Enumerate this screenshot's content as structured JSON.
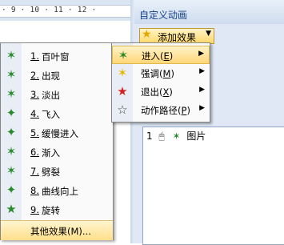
{
  "ruler": {
    "text": "· 9 · 10 · 11 · 12 ·"
  },
  "task_pane": {
    "title": "自定义动画",
    "add_effect_label": "添加效果",
    "list_item": {
      "index": "1",
      "text": "图片"
    }
  },
  "context_menu": {
    "items": [
      {
        "icon": "green-star-icon",
        "label": "进入(",
        "key": "E",
        "end": ")"
      },
      {
        "icon": "yellow-star-icon",
        "label": "强调(",
        "key": "M",
        "end": ")"
      },
      {
        "icon": "red-star-icon",
        "label": "退出(",
        "key": "X",
        "end": ")"
      },
      {
        "icon": "outline-star-icon",
        "label": "动作路径(",
        "key": "P",
        "end": ")"
      }
    ]
  },
  "effect_submenu": {
    "items": [
      {
        "num": "1.",
        "label": "百叶窗"
      },
      {
        "num": "2.",
        "label": "出现"
      },
      {
        "num": "3.",
        "label": "淡出"
      },
      {
        "num": "4.",
        "label": "飞入"
      },
      {
        "num": "5.",
        "label": "缓慢进入"
      },
      {
        "num": "6.",
        "label": "渐入"
      },
      {
        "num": "7.",
        "label": "劈裂"
      },
      {
        "num": "8.",
        "label": "曲线向上"
      },
      {
        "num": "9.",
        "label": "旋转"
      }
    ],
    "more_label": "其他效果(M)..."
  },
  "colors": {
    "accent_highlight": "#ffd778",
    "pane_title_text": "#15428b",
    "entrance_green": "#2b8a2b"
  }
}
